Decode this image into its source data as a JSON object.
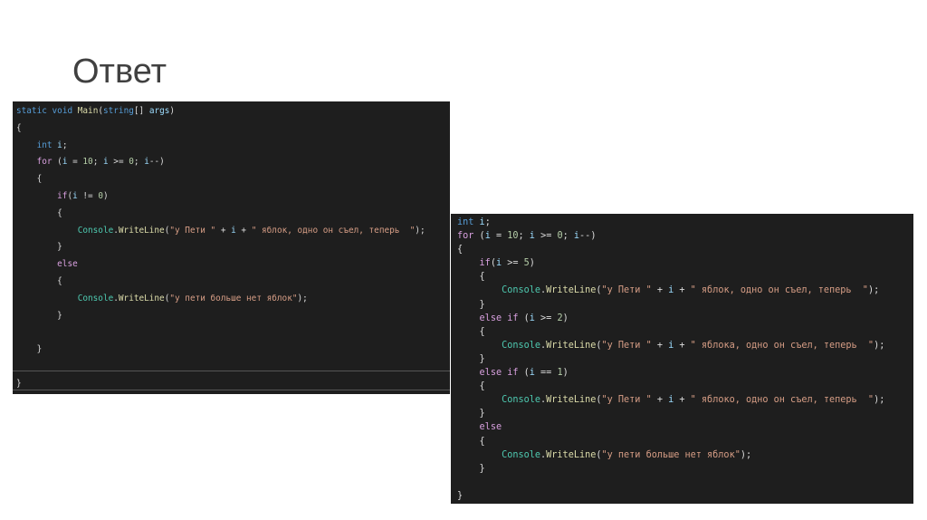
{
  "slide": {
    "title": "Ответ"
  },
  "colors": {
    "background": "#1e1e1e",
    "keyword": "#569cd6",
    "control": "#d8a0df",
    "class": "#4ec9b0",
    "method": "#dcdcaa",
    "string": "#d69d85",
    "number": "#b5cea8",
    "variable": "#9cdcfe"
  },
  "left": {
    "lines": [
      [
        [
          "kw",
          "static"
        ],
        [
          "pl",
          " "
        ],
        [
          "kw",
          "void"
        ],
        [
          "pl",
          " "
        ],
        [
          "mth",
          "Main"
        ],
        [
          "pl",
          "("
        ],
        [
          "kw",
          "string"
        ],
        [
          "pl",
          "[] "
        ],
        [
          "var",
          "args"
        ],
        [
          "pl",
          ")"
        ]
      ],
      [
        [
          "pl",
          "{"
        ]
      ],
      [
        [
          "pl",
          "    "
        ],
        [
          "kw",
          "int"
        ],
        [
          "pl",
          " "
        ],
        [
          "var",
          "i"
        ],
        [
          "pl",
          ";"
        ]
      ],
      [
        [
          "pl",
          "    "
        ],
        [
          "ctl",
          "for"
        ],
        [
          "pl",
          " ("
        ],
        [
          "var",
          "i"
        ],
        [
          "pl",
          " = "
        ],
        [
          "num",
          "10"
        ],
        [
          "pl",
          "; "
        ],
        [
          "var",
          "i"
        ],
        [
          "pl",
          " >= "
        ],
        [
          "num",
          "0"
        ],
        [
          "pl",
          "; "
        ],
        [
          "var",
          "i"
        ],
        [
          "pl",
          "--)"
        ]
      ],
      [
        [
          "pl",
          "    {"
        ]
      ],
      [
        [
          "pl",
          "        "
        ],
        [
          "ctl",
          "if"
        ],
        [
          "pl",
          "("
        ],
        [
          "var",
          "i"
        ],
        [
          "pl",
          " != "
        ],
        [
          "num",
          "0"
        ],
        [
          "pl",
          ")"
        ]
      ],
      [
        [
          "pl",
          "        {"
        ]
      ],
      [
        [
          "pl",
          "            "
        ],
        [
          "cls",
          "Console"
        ],
        [
          "pl",
          "."
        ],
        [
          "mth",
          "WriteLine"
        ],
        [
          "pl",
          "("
        ],
        [
          "str",
          "\"у Пети \""
        ],
        [
          "pl",
          " + "
        ],
        [
          "var",
          "i"
        ],
        [
          "pl",
          " + "
        ],
        [
          "str",
          "\" яблок, одно он съел, теперь  \""
        ],
        [
          "pl",
          ");"
        ]
      ],
      [
        [
          "pl",
          "        }"
        ]
      ],
      [
        [
          "pl",
          "        "
        ],
        [
          "ctl",
          "else"
        ]
      ],
      [
        [
          "pl",
          "        {"
        ]
      ],
      [
        [
          "pl",
          "            "
        ],
        [
          "cls",
          "Console"
        ],
        [
          "pl",
          "."
        ],
        [
          "mth",
          "WriteLine"
        ],
        [
          "pl",
          "("
        ],
        [
          "str",
          "\"у пети больше нет яблок\""
        ],
        [
          "pl",
          ");"
        ]
      ],
      [
        [
          "pl",
          "        }"
        ]
      ],
      [
        [
          "pl",
          " "
        ]
      ],
      [
        [
          "pl",
          "    }"
        ]
      ],
      [
        [
          "pl",
          " "
        ]
      ],
      [
        [
          "pl",
          "}"
        ]
      ]
    ]
  },
  "right": {
    "lines": [
      [
        [
          "kw",
          "int"
        ],
        [
          "pl",
          " "
        ],
        [
          "var",
          "i"
        ],
        [
          "pl",
          ";"
        ]
      ],
      [
        [
          "ctl",
          "for"
        ],
        [
          "pl",
          " ("
        ],
        [
          "var",
          "i"
        ],
        [
          "pl",
          " = "
        ],
        [
          "num",
          "10"
        ],
        [
          "pl",
          "; "
        ],
        [
          "var",
          "i"
        ],
        [
          "pl",
          " >= "
        ],
        [
          "num",
          "0"
        ],
        [
          "pl",
          "; "
        ],
        [
          "var",
          "i"
        ],
        [
          "pl",
          "--)"
        ]
      ],
      [
        [
          "pl",
          "{"
        ]
      ],
      [
        [
          "pl",
          "    "
        ],
        [
          "ctl",
          "if"
        ],
        [
          "pl",
          "("
        ],
        [
          "var",
          "i"
        ],
        [
          "pl",
          " >= "
        ],
        [
          "num",
          "5"
        ],
        [
          "pl",
          ")"
        ]
      ],
      [
        [
          "pl",
          "    {"
        ]
      ],
      [
        [
          "pl",
          "        "
        ],
        [
          "cls",
          "Console"
        ],
        [
          "pl",
          "."
        ],
        [
          "mth",
          "WriteLine"
        ],
        [
          "pl",
          "("
        ],
        [
          "str",
          "\"у Пети \""
        ],
        [
          "pl",
          " + "
        ],
        [
          "var",
          "i"
        ],
        [
          "pl",
          " + "
        ],
        [
          "str",
          "\" яблок, одно он съел, теперь  \""
        ],
        [
          "pl",
          ");"
        ]
      ],
      [
        [
          "pl",
          "    }"
        ]
      ],
      [
        [
          "pl",
          "    "
        ],
        [
          "ctl",
          "else if"
        ],
        [
          "pl",
          " ("
        ],
        [
          "var",
          "i"
        ],
        [
          "pl",
          " >= "
        ],
        [
          "num",
          "2"
        ],
        [
          "pl",
          ")"
        ]
      ],
      [
        [
          "pl",
          "    {"
        ]
      ],
      [
        [
          "pl",
          "        "
        ],
        [
          "cls",
          "Console"
        ],
        [
          "pl",
          "."
        ],
        [
          "mth",
          "WriteLine"
        ],
        [
          "pl",
          "("
        ],
        [
          "str",
          "\"у Пети \""
        ],
        [
          "pl",
          " + "
        ],
        [
          "var",
          "i"
        ],
        [
          "pl",
          " + "
        ],
        [
          "str",
          "\" яблока, одно он съел, теперь  \""
        ],
        [
          "pl",
          ");"
        ]
      ],
      [
        [
          "pl",
          "    }"
        ]
      ],
      [
        [
          "pl",
          "    "
        ],
        [
          "ctl",
          "else if"
        ],
        [
          "pl",
          " ("
        ],
        [
          "var",
          "i"
        ],
        [
          "pl",
          " == "
        ],
        [
          "num",
          "1"
        ],
        [
          "pl",
          ")"
        ]
      ],
      [
        [
          "pl",
          "    {"
        ]
      ],
      [
        [
          "pl",
          "        "
        ],
        [
          "cls",
          "Console"
        ],
        [
          "pl",
          "."
        ],
        [
          "mth",
          "WriteLine"
        ],
        [
          "pl",
          "("
        ],
        [
          "str",
          "\"у Пети \""
        ],
        [
          "pl",
          " + "
        ],
        [
          "var",
          "i"
        ],
        [
          "pl",
          " + "
        ],
        [
          "str",
          "\" яблоко, одно он съел, теперь  \""
        ],
        [
          "pl",
          ");"
        ]
      ],
      [
        [
          "pl",
          "    }"
        ]
      ],
      [
        [
          "pl",
          "    "
        ],
        [
          "ctl",
          "else"
        ]
      ],
      [
        [
          "pl",
          "    {"
        ]
      ],
      [
        [
          "pl",
          "        "
        ],
        [
          "cls",
          "Console"
        ],
        [
          "pl",
          "."
        ],
        [
          "mth",
          "WriteLine"
        ],
        [
          "pl",
          "("
        ],
        [
          "str",
          "\"у пети больше нет яблок\""
        ],
        [
          "pl",
          ");"
        ]
      ],
      [
        [
          "pl",
          "    }"
        ]
      ],
      [
        [
          "pl",
          " "
        ]
      ],
      [
        [
          "pl",
          "}"
        ]
      ]
    ]
  }
}
